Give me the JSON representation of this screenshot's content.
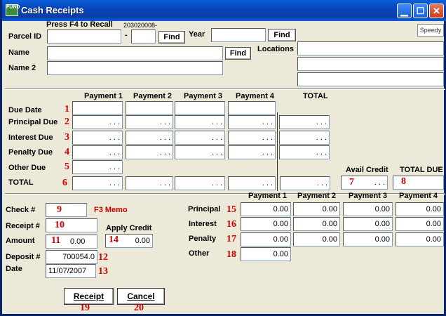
{
  "window": {
    "title": "Cash Receipts",
    "icon_text": "FUND"
  },
  "header": {
    "recall_hint": "Press F4 to Recall",
    "recall_code": "203020008-",
    "parcel_label": "Parcel ID",
    "dash": "-",
    "find_label": "Find",
    "year_label": "Year",
    "name_label": "Name",
    "name2_label": "Name 2",
    "locations_label": "Locations",
    "speedy_label": "Speedy"
  },
  "due_grid": {
    "columns": [
      "Payment 1",
      "Payment 2",
      "Payment 3",
      "Payment 4",
      "TOTAL"
    ],
    "rows": [
      {
        "label": "Due Date",
        "num": "1"
      },
      {
        "label": "Principal Due",
        "num": "2"
      },
      {
        "label": "Interest Due",
        "num": "3"
      },
      {
        "label": "Penalty Due",
        "num": "4"
      },
      {
        "label": "Other Due",
        "num": "5"
      },
      {
        "label": "TOTAL",
        "num": "6"
      }
    ],
    "empty_amount": ". . .",
    "avail_credit_label": "Avail Credit",
    "avail_credit_num": "7",
    "total_due_label": "TOTAL DUE",
    "total_due_num": "8"
  },
  "receipt": {
    "check_label": "Check #",
    "check_num": "9",
    "f3_memo": "F3 Memo",
    "receipt_label": "Receipt #",
    "receipt_num": "10",
    "amount_label": "Amount",
    "amount_num": "11",
    "amount_value": "0.00",
    "apply_credit_label": "Apply Credit",
    "apply_credit_num": "14",
    "apply_credit_value": "0.00",
    "deposit_label": "Deposit #",
    "deposit_value": "700054.0",
    "deposit_num": "12",
    "date_label": "Date",
    "date_value": "11/07/2007",
    "date_num": "13"
  },
  "distribution": {
    "columns": [
      "Payment 1",
      "Payment 2",
      "Payment 3",
      "Payment 4"
    ],
    "rows": [
      {
        "label": "Principal",
        "num": "15",
        "values": [
          "0.00",
          "0.00",
          "0.00",
          "0.00"
        ]
      },
      {
        "label": "Interest",
        "num": "16",
        "values": [
          "0.00",
          "0.00",
          "0.00",
          "0.00"
        ]
      },
      {
        "label": "Penalty",
        "num": "17",
        "values": [
          "0.00",
          "0.00",
          "0.00",
          "0.00"
        ]
      },
      {
        "label": "Other",
        "num": "18",
        "values": [
          "0.00"
        ]
      }
    ]
  },
  "buttons": {
    "receipt_label": "Receipt",
    "receipt_num": "19",
    "cancel_label": "Cancel",
    "cancel_num": "20"
  }
}
